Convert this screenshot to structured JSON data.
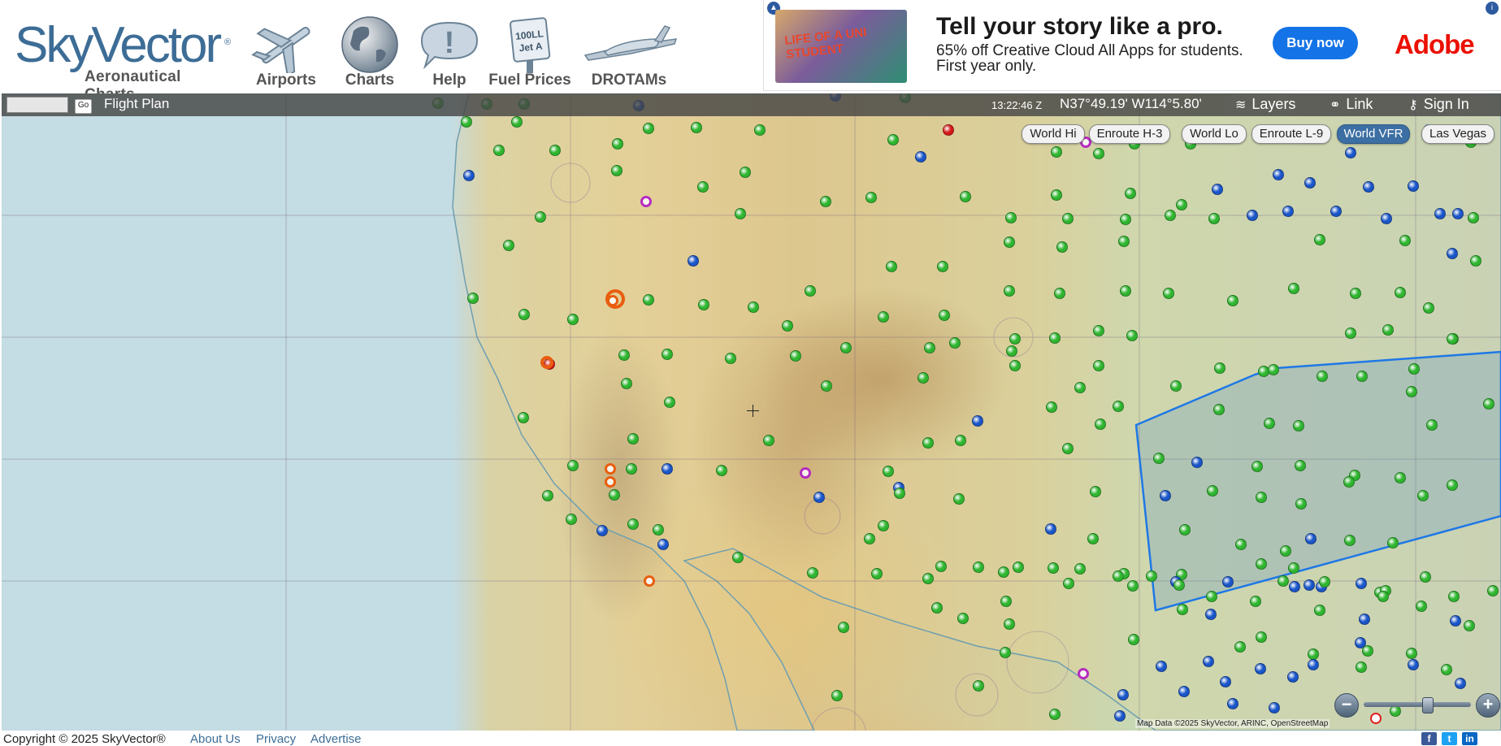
{
  "app": {
    "logo_text": "SkyVector",
    "logo_registered": "®",
    "logo_subtitle": "Aeronautical Charts"
  },
  "nav": {
    "items": [
      {
        "label": "Airports",
        "icon": "airplane-icon"
      },
      {
        "label": "Charts",
        "icon": "globe-icon"
      },
      {
        "label": "Help",
        "icon": "help-bubble-icon"
      },
      {
        "label": "Fuel Prices",
        "icon": "fuel-sign-icon",
        "sign_line1": "100LL",
        "sign_line2": "Jet A"
      },
      {
        "label": "DROTAMs",
        "icon": "drone-icon"
      }
    ]
  },
  "ad": {
    "photo_text": "LIFE OF A UNI STUDENT",
    "headline": "Tell your story like a pro.",
    "body": "65% off Creative Cloud All Apps for students. First year only.",
    "button_label": "Buy now",
    "brand": "Adobe",
    "brand_color": "#eb1000",
    "button_color": "#1473e6"
  },
  "toolbar": {
    "search_value": "",
    "go_label": "Go",
    "flight_plan_label": "Flight Plan",
    "utc_time": "13:22:46 Z",
    "coordinates": "N37°49.19' W114°5.80'",
    "layers_label": "Layers",
    "link_label": "Link",
    "sign_in_label": "Sign In"
  },
  "charts": {
    "tabs": [
      {
        "label": "World Hi",
        "active": false
      },
      {
        "label": "Enroute H-3",
        "active": false
      },
      {
        "label": "World Lo",
        "active": false
      },
      {
        "label": "Enroute L-9",
        "active": false
      },
      {
        "label": "World VFR",
        "active": true
      },
      {
        "label": "Las Vegas",
        "active": false
      }
    ]
  },
  "map": {
    "attribution": "Map Data ©2025 SkyVector, ARINC, OpenStreetMap",
    "zoom_level_fraction": 0.6,
    "colors": {
      "ocean": "#c4dce3",
      "towered_airport": "#1b56c8",
      "untowered_airport": "#2fb52f",
      "special_airport": "#b52cc0",
      "restricted": "#e95d0f",
      "tfr_outline": "#1e78e6"
    }
  },
  "footer": {
    "copyright": "Copyright © 2025 SkyVector®",
    "links": [
      "About Us",
      "Privacy",
      "Advertise"
    ],
    "social": [
      "facebook-icon",
      "twitter-icon",
      "linkedin-icon"
    ]
  }
}
